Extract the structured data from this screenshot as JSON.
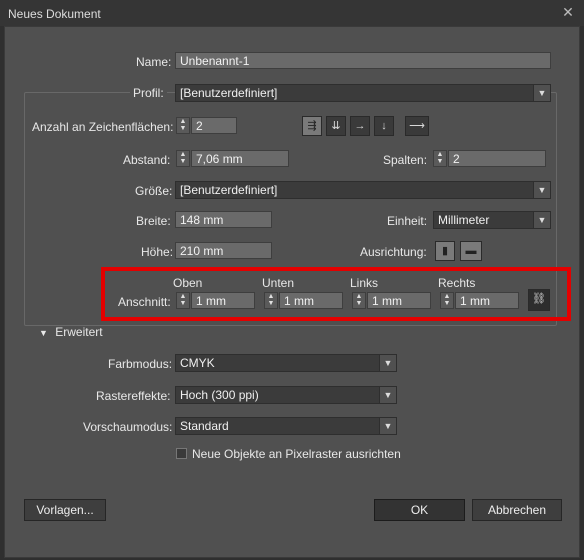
{
  "window": {
    "title": "Neues Dokument",
    "close_glyph": "✕"
  },
  "name": {
    "label": "Name:",
    "value": "Unbenannt-1"
  },
  "profile": {
    "label": "Profil:",
    "value": "[Benutzerdefiniert]"
  },
  "artboards": {
    "label": "Anzahl an Zeichenflächen:",
    "value": "2",
    "icons": [
      "grid-by-row-icon",
      "grid-by-column-icon",
      "arrange-by-row-icon",
      "arrange-by-column-icon",
      "right-to-left-icon"
    ]
  },
  "spacing": {
    "label": "Abstand:",
    "value": "7,06 mm"
  },
  "columns": {
    "label": "Spalten:",
    "value": "2"
  },
  "size": {
    "label": "Größe:",
    "value": "[Benutzerdefiniert]"
  },
  "width": {
    "label": "Breite:",
    "value": "148 mm"
  },
  "units": {
    "label": "Einheit:",
    "value": "Millimeter"
  },
  "height": {
    "label": "Höhe:",
    "value": "210 mm"
  },
  "orientation": {
    "label": "Ausrichtung:"
  },
  "bleed": {
    "label": "Anschnitt:",
    "top": {
      "label": "Oben",
      "value": "1 mm"
    },
    "bottom": {
      "label": "Unten",
      "value": "1 mm"
    },
    "left": {
      "label": "Links",
      "value": "1 mm"
    },
    "right": {
      "label": "Rechts",
      "value": "1 mm"
    }
  },
  "advanced": {
    "label": "Erweitert",
    "expanded": true
  },
  "color_mode": {
    "label": "Farbmodus:",
    "value": "CMYK"
  },
  "raster_effects": {
    "label": "Rastereffekte:",
    "value": "Hoch (300 ppi)"
  },
  "preview_mode": {
    "label": "Vorschaumodus:",
    "value": "Standard"
  },
  "pixel_grid": {
    "label": "Neue Objekte an Pixelraster ausrichten",
    "checked": false
  },
  "buttons": {
    "templates": "Vorlagen...",
    "ok": "OK",
    "cancel": "Abbrechen"
  },
  "colors": {
    "highlight": "#e40000",
    "panel": "#505050",
    "field": "#6a6a6a"
  }
}
